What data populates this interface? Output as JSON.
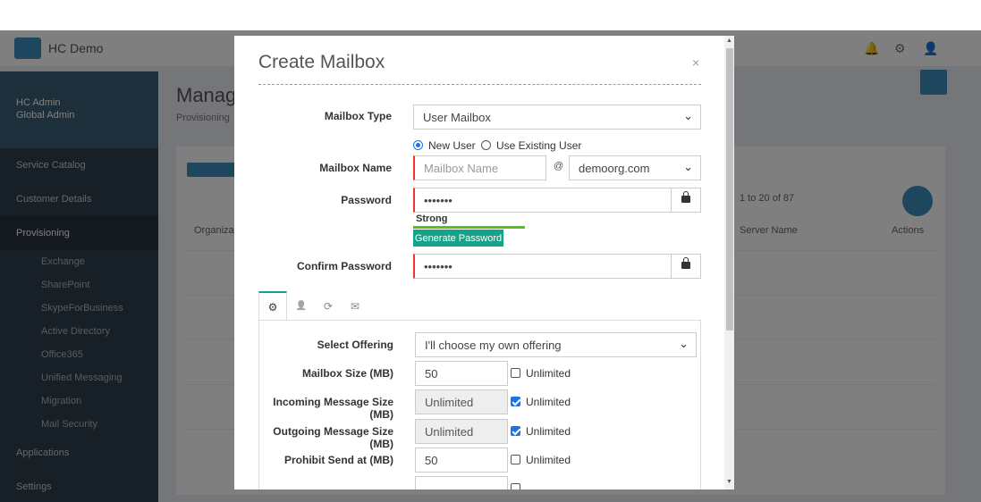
{
  "background": {
    "brand": "HC Demo",
    "sidebar_user": [
      "HC Admin",
      "Global Admin"
    ],
    "sidebar_items": [
      "Service Catalog",
      "Customer Details",
      "Provisioning",
      "Applications",
      "Settings"
    ],
    "sidebar_sub": [
      "Exchange",
      "SharePoint",
      "SkypeForBusiness",
      "Active Directory",
      "Office365",
      "Unified Messaging",
      "Migration",
      "Mail Security"
    ],
    "main_title": "Manage",
    "main_breadcrumb": "Provisioning",
    "pagination": "1 to 20 of 87",
    "columns": [
      "Organization",
      "Server Name",
      "Actions"
    ]
  },
  "modal": {
    "title": "Create Mailbox",
    "close": "×",
    "mailbox_type": {
      "label": "Mailbox Type",
      "value": "User Mailbox"
    },
    "radio": {
      "new_user": "New User",
      "existing_user": "Use Existing User"
    },
    "mailbox_name": {
      "label": "Mailbox Name",
      "placeholder": "Mailbox Name",
      "at": "@",
      "domain": "demoorg.com"
    },
    "password": {
      "label": "Password",
      "value": "•••••••"
    },
    "strength": "Strong",
    "strength_fraction": 0.5,
    "generate_password": "Generate Password",
    "confirm_password": {
      "label": "Confirm Password",
      "value": "•••••••"
    },
    "tabs": [
      {
        "icon": "gears-icon",
        "glyph": "⚙"
      },
      {
        "icon": "user-icon",
        "glyph": "👤"
      },
      {
        "icon": "refresh-icon",
        "glyph": "⟳"
      },
      {
        "icon": "envelope-icon",
        "glyph": "✉"
      }
    ],
    "offering": {
      "label": "Select Offering",
      "value": "I'll choose my own offering"
    },
    "rows": [
      {
        "label": "Mailbox Size (MB)",
        "value": "50",
        "disabled": false,
        "unlimited": false,
        "unlimited_label": "Unlimited"
      },
      {
        "label": "Incoming Message Size (MB)",
        "value": "Unlimited",
        "disabled": true,
        "unlimited": true,
        "unlimited_label": "Unlimited"
      },
      {
        "label": "Outgoing Message Size (MB)",
        "value": "Unlimited",
        "disabled": true,
        "unlimited": true,
        "unlimited_label": "Unlimited"
      },
      {
        "label": "Prohibit Send at (MB)",
        "value": "50",
        "disabled": false,
        "unlimited": false,
        "unlimited_label": "Unlimited"
      }
    ]
  },
  "colors": {
    "accent_green": "#14a388",
    "strength_green": "#54c31b",
    "error_red": "#e33333",
    "check_blue": "#1a73e8"
  }
}
